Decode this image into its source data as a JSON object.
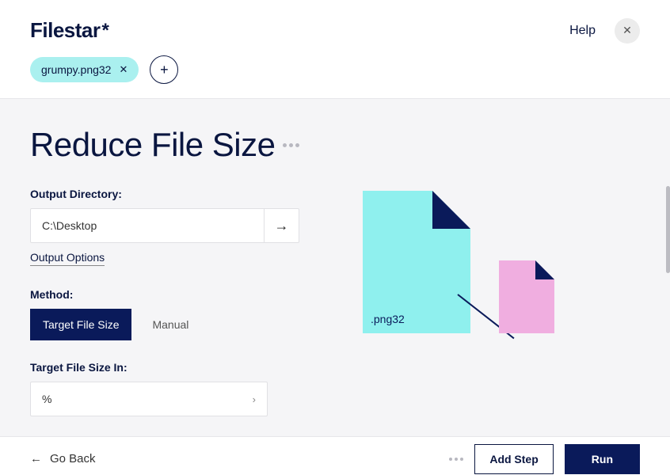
{
  "app": {
    "name": "Filestar",
    "logo_suffix": "*"
  },
  "topbar": {
    "help": "Help"
  },
  "chips": {
    "file": "grumpy.png32"
  },
  "page": {
    "title": "Reduce File Size"
  },
  "form": {
    "output_dir_label": "Output Directory:",
    "output_dir_value": "C:\\Desktop",
    "output_options": "Output Options",
    "method_label": "Method:",
    "method_target": "Target File Size",
    "method_manual": "Manual",
    "target_size_label": "Target File Size In:",
    "target_size_unit": "%"
  },
  "illustration": {
    "ext": ".png32"
  },
  "footer": {
    "go_back": "Go Back",
    "add_step": "Add Step",
    "run": "Run"
  }
}
